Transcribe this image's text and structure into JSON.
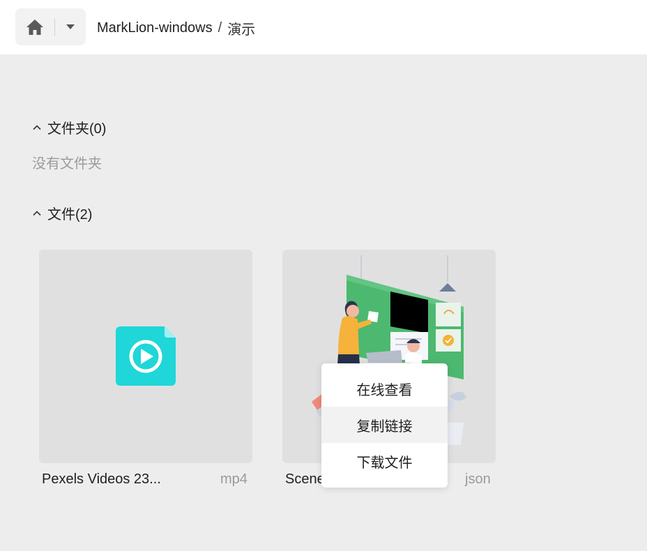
{
  "breadcrumb": {
    "items": [
      "MarkLion-windows",
      "演示"
    ],
    "separator": "/"
  },
  "icons": {
    "home": "home-icon",
    "dropdown": "caret-down-icon",
    "collapse": "chevron-up-icon",
    "video_file": "video-file-icon"
  },
  "sections": {
    "folders": {
      "title": "文件夹(0)",
      "empty_text": "没有文件夹"
    },
    "files": {
      "title": "文件(2)"
    }
  },
  "files": [
    {
      "name": "Pexels Videos 23...",
      "ext": "mp4"
    },
    {
      "name": "Scene",
      "ext": "json"
    }
  ],
  "context_menu": {
    "items": [
      "在线查看",
      "复制链接",
      "下载文件"
    ],
    "hovered_index": 1
  },
  "colors": {
    "background": "#ededed",
    "topbar": "#ffffff",
    "card": "#e0e0e0",
    "video_icon": "#1fd6d9",
    "board_green": "#4db870"
  }
}
